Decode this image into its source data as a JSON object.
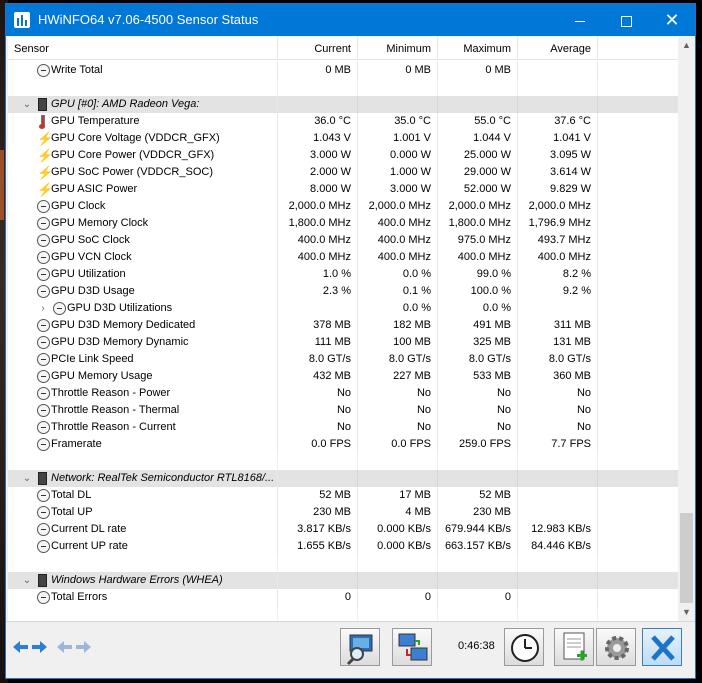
{
  "window": {
    "title": "HWiNFO64 v7.06-4500 Sensor Status",
    "controls": {
      "minimize": "minimize",
      "maximize": "maximize",
      "close": "✕"
    }
  },
  "table": {
    "headers": {
      "sensor": "Sensor",
      "current": "Current",
      "minimum": "Minimum",
      "maximum": "Maximum",
      "average": "Average"
    },
    "rows": [
      {
        "kind": "sensor",
        "icon": "clock-icon",
        "label": "Write Total",
        "current": "0 MB",
        "minimum": "0 MB",
        "maximum": "0 MB",
        "average": ""
      },
      {
        "kind": "blank"
      },
      {
        "kind": "group",
        "label": "GPU [#0]: AMD Radeon Vega:"
      },
      {
        "kind": "sensor",
        "icon": "thermometer-icon",
        "label": "GPU Temperature",
        "current": "36.0 °C",
        "minimum": "35.0 °C",
        "maximum": "55.0 °C",
        "average": "37.6 °C"
      },
      {
        "kind": "sensor",
        "icon": "lightning-icon",
        "label": "GPU Core Voltage (VDDCR_GFX)",
        "current": "1.043 V",
        "minimum": "1.001 V",
        "maximum": "1.044 V",
        "average": "1.041 V"
      },
      {
        "kind": "sensor",
        "icon": "lightning-icon",
        "label": "GPU Core Power (VDDCR_GFX)",
        "current": "3.000 W",
        "minimum": "0.000 W",
        "maximum": "25.000 W",
        "average": "3.095 W"
      },
      {
        "kind": "sensor",
        "icon": "lightning-icon",
        "label": "GPU SoC Power (VDDCR_SOC)",
        "current": "2.000 W",
        "minimum": "1.000 W",
        "maximum": "29.000 W",
        "average": "3.614 W"
      },
      {
        "kind": "sensor",
        "icon": "lightning-icon",
        "label": "GPU ASIC Power",
        "current": "8.000 W",
        "minimum": "3.000 W",
        "maximum": "52.000 W",
        "average": "9.829 W"
      },
      {
        "kind": "sensor",
        "icon": "clock-icon",
        "label": "GPU Clock",
        "current": "2,000.0 MHz",
        "minimum": "2,000.0 MHz",
        "maximum": "2,000.0 MHz",
        "average": "2,000.0 MHz"
      },
      {
        "kind": "sensor",
        "icon": "clock-icon",
        "label": "GPU Memory Clock",
        "current": "1,800.0 MHz",
        "minimum": "400.0 MHz",
        "maximum": "1,800.0 MHz",
        "average": "1,796.9 MHz"
      },
      {
        "kind": "sensor",
        "icon": "clock-icon",
        "label": "GPU SoC Clock",
        "current": "400.0 MHz",
        "minimum": "400.0 MHz",
        "maximum": "975.0 MHz",
        "average": "493.7 MHz"
      },
      {
        "kind": "sensor",
        "icon": "clock-icon",
        "label": "GPU VCN Clock",
        "current": "400.0 MHz",
        "minimum": "400.0 MHz",
        "maximum": "400.0 MHz",
        "average": "400.0 MHz"
      },
      {
        "kind": "sensor",
        "icon": "clock-icon",
        "label": "GPU Utilization",
        "current": "1.0 %",
        "minimum": "0.0 %",
        "maximum": "99.0 %",
        "average": "8.2 %"
      },
      {
        "kind": "sensor",
        "icon": "clock-icon",
        "label": "GPU D3D Usage",
        "current": "2.3 %",
        "minimum": "0.1 %",
        "maximum": "100.0 %",
        "average": "9.2 %"
      },
      {
        "kind": "subgroup",
        "icon": "clock-icon",
        "label": "GPU D3D Utilizations",
        "current": "",
        "minimum": "0.0 %",
        "maximum": "0.0 %",
        "average": ""
      },
      {
        "kind": "sensor",
        "icon": "clock-icon",
        "label": "GPU D3D Memory Dedicated",
        "current": "378 MB",
        "minimum": "182 MB",
        "maximum": "491 MB",
        "average": "311 MB"
      },
      {
        "kind": "sensor",
        "icon": "clock-icon",
        "label": "GPU D3D Memory Dynamic",
        "current": "111 MB",
        "minimum": "100 MB",
        "maximum": "325 MB",
        "average": "131 MB"
      },
      {
        "kind": "sensor",
        "icon": "clock-icon",
        "label": "PCIe Link Speed",
        "current": "8.0 GT/s",
        "minimum": "8.0 GT/s",
        "maximum": "8.0 GT/s",
        "average": "8.0 GT/s"
      },
      {
        "kind": "sensor",
        "icon": "clock-icon",
        "label": "GPU Memory Usage",
        "current": "432 MB",
        "minimum": "227 MB",
        "maximum": "533 MB",
        "average": "360 MB"
      },
      {
        "kind": "sensor",
        "icon": "clock-icon",
        "label": "Throttle Reason - Power",
        "current": "No",
        "minimum": "No",
        "maximum": "No",
        "average": "No"
      },
      {
        "kind": "sensor",
        "icon": "clock-icon",
        "label": "Throttle Reason - Thermal",
        "current": "No",
        "minimum": "No",
        "maximum": "No",
        "average": "No"
      },
      {
        "kind": "sensor",
        "icon": "clock-icon",
        "label": "Throttle Reason - Current",
        "current": "No",
        "minimum": "No",
        "maximum": "No",
        "average": "No"
      },
      {
        "kind": "sensor",
        "icon": "clock-icon",
        "label": "Framerate",
        "current": "0.0 FPS",
        "minimum": "0.0 FPS",
        "maximum": "259.0 FPS",
        "average": "7.7 FPS"
      },
      {
        "kind": "blank"
      },
      {
        "kind": "group",
        "label": "Network: RealTek Semiconductor RTL8168/..."
      },
      {
        "kind": "sensor",
        "icon": "clock-icon",
        "label": "Total DL",
        "current": "52 MB",
        "minimum": "17 MB",
        "maximum": "52 MB",
        "average": ""
      },
      {
        "kind": "sensor",
        "icon": "clock-icon",
        "label": "Total UP",
        "current": "230 MB",
        "minimum": "4 MB",
        "maximum": "230 MB",
        "average": ""
      },
      {
        "kind": "sensor",
        "icon": "clock-icon",
        "label": "Current DL rate",
        "current": "3.817 KB/s",
        "minimum": "0.000 KB/s",
        "maximum": "679.944 KB/s",
        "average": "12.983 KB/s"
      },
      {
        "kind": "sensor",
        "icon": "clock-icon",
        "label": "Current UP rate",
        "current": "1.655 KB/s",
        "minimum": "0.000 KB/s",
        "maximum": "663.157 KB/s",
        "average": "84.446 KB/s"
      },
      {
        "kind": "blank"
      },
      {
        "kind": "group",
        "label": "Windows Hardware Errors (WHEA)"
      },
      {
        "kind": "sensor",
        "icon": "clock-icon",
        "label": "Total Errors",
        "current": "0",
        "minimum": "0",
        "maximum": "0",
        "average": ""
      },
      {
        "kind": "blank"
      }
    ]
  },
  "toolbar": {
    "timer": "0:46:38",
    "buttons": [
      "navigate-left-right",
      "navigate-disabled",
      "sensor-report",
      "network",
      "clock",
      "add-log",
      "settings",
      "close"
    ]
  },
  "colors": {
    "titlebar": "#0078d7",
    "group_row": "#e3e3e3",
    "bolt": "#f2c200"
  }
}
